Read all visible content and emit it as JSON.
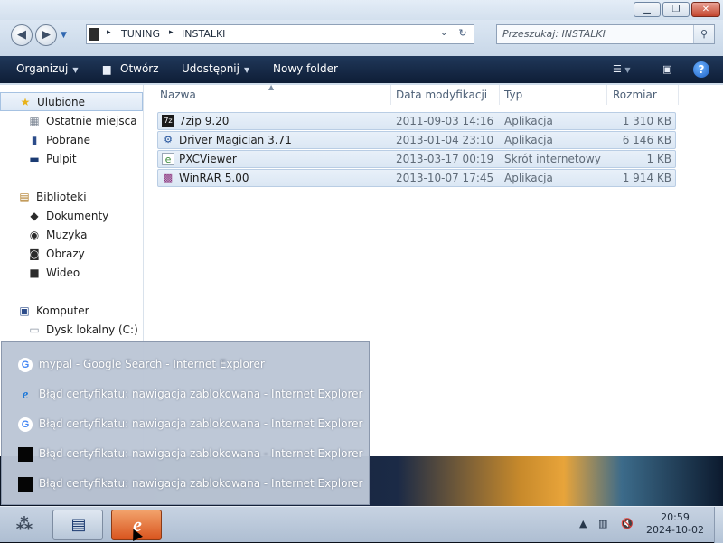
{
  "window": {
    "controls": {
      "minimize": "▁",
      "maximize": "❐",
      "close": "✕"
    }
  },
  "address": {
    "segments": [
      "TUNING",
      "INSTALKI"
    ],
    "separator": "▸"
  },
  "search": {
    "placeholder": "Przeszukaj: INSTALKI"
  },
  "toolbar": {
    "organize": "Organizuj",
    "open": "Otwórz",
    "share": "Udostępnij",
    "new_folder": "Nowy folder",
    "help": "?"
  },
  "sidebar": {
    "favorites": {
      "label": "Ulubione",
      "items": [
        "Ostatnie miejsca",
        "Pobrane",
        "Pulpit"
      ]
    },
    "libraries": {
      "label": "Biblioteki",
      "items": [
        "Dokumenty",
        "Muzyka",
        "Obrazy",
        "Wideo"
      ]
    },
    "computer": {
      "label": "Komputer",
      "items": [
        "Dysk lokalny (C:)"
      ]
    }
  },
  "file_list": {
    "columns": [
      "Nazwa",
      "Data modyfikacji",
      "Typ",
      "Rozmiar"
    ],
    "rows": [
      {
        "name": "7zip 9.20",
        "date": "2011-09-03 14:16",
        "type": "Aplikacja",
        "size": "1 310 KB",
        "icon": "7zip-icon"
      },
      {
        "name": "Driver Magician 3.71",
        "date": "2013-01-04 23:10",
        "type": "Aplikacja",
        "size": "6 146 KB",
        "icon": "driver-magician-icon"
      },
      {
        "name": "PXCViewer",
        "date": "2013-03-17 00:19",
        "type": "Skrót internetowy",
        "size": "1 KB",
        "icon": "internet-shortcut-icon"
      },
      {
        "name": "WinRAR 5.00",
        "date": "2013-10-07 17:45",
        "type": "Aplikacja",
        "size": "1 914 KB",
        "icon": "winrar-icon"
      }
    ]
  },
  "taskbar_popup": {
    "items": [
      {
        "title": "mypal - Google Search - Internet Explorer",
        "icon": "google-icon"
      },
      {
        "title": "Błąd certyfikatu: nawigacja zablokowana - Internet Explorer",
        "icon": "internet-explorer-icon"
      },
      {
        "title": "Błąd certyfikatu: nawigacja zablokowana - Internet Explorer",
        "icon": "google-icon"
      },
      {
        "title": "Błąd certyfikatu: nawigacja zablokowana - Internet Explorer",
        "icon": "black-page-icon"
      },
      {
        "title": "Błąd certyfikatu: nawigacja zablokowana - Internet Explorer",
        "icon": "black-page-icon"
      }
    ]
  },
  "taskbar": {
    "clock_time": "20:59",
    "clock_date": "2024-10-02"
  }
}
